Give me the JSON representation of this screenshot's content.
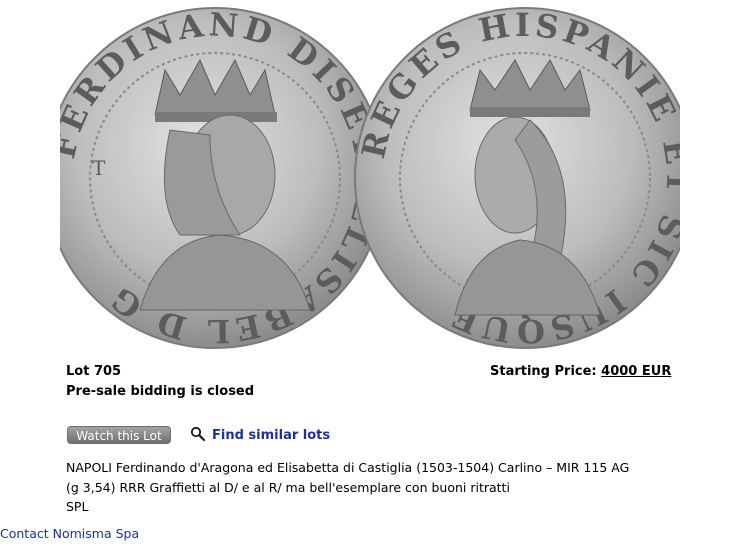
{
  "images": {
    "obverse_legend": "FERDINAND DISETHELISABEL D G",
    "reverse_legend": "REGES HISPANIE ET SIC IUSQUE"
  },
  "lot": {
    "number_label": "Lot 705",
    "bidding_status": "Pre-sale bidding is closed",
    "starting_price_label": "Starting Price:",
    "starting_price_value": "4000 EUR"
  },
  "actions": {
    "watch_label": "Watch this Lot",
    "find_similar_label": "Find similar lots",
    "search_icon": "magnifier-icon"
  },
  "description": {
    "line1": "NAPOLI Ferdinando d'Aragona ed Elisabetta di Castiglia (1503-1504) Carlino – MIR 115 AG",
    "line2": "(g 3,54) RRR Graffietti al D/ e al R/ ma bell'esemplare con buoni ritratti",
    "grade": "SPL"
  },
  "footer": {
    "contact_label": "Contact Nomisma Spa"
  },
  "colors": {
    "link": "#1e2fa0",
    "coin_silver": "#c9c9c9",
    "coin_dark": "#6a6a6a"
  }
}
